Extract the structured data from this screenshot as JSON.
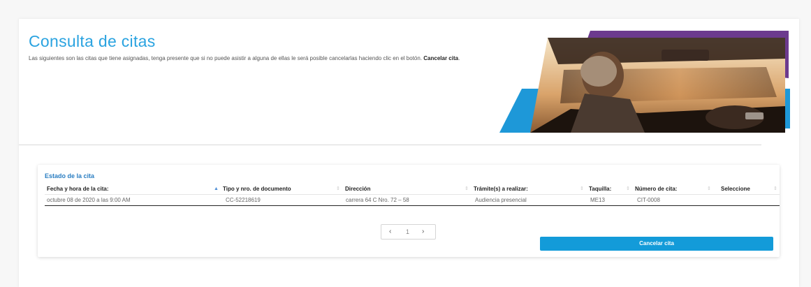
{
  "title": "Consulta de citas",
  "intro": {
    "text": "Las siguientes son las citas que tiene asignadas, tenga presente que si no puede asistir a alguna de ellas le será posible cancelarlas haciendo clic en el botón. ",
    "bold": "Cancelar cita",
    "end": "."
  },
  "panel": {
    "title": "Estado de la cita",
    "columns": [
      "Fecha y hora de la cita:",
      "Tipo y nro. de documento",
      "Dirección",
      "Trámite(s) a realizar:",
      "Taquilla:",
      "Número de cita:",
      "Seleccione"
    ],
    "rows": [
      [
        "octubre 08 de 2020 a las 9:00 AM",
        "CC-52218619",
        "carrera 64 C Nro. 72 – 58",
        "Audiencia presencial",
        "ME13",
        "CIT-0008",
        ""
      ]
    ]
  },
  "pager": {
    "prev": "‹",
    "page": "1",
    "next": "›"
  },
  "button": {
    "label": "Cancelar cita"
  },
  "colors": {
    "accent": "#2aa3e0",
    "button": "#139bd9",
    "purple": "#6c3a8e"
  }
}
